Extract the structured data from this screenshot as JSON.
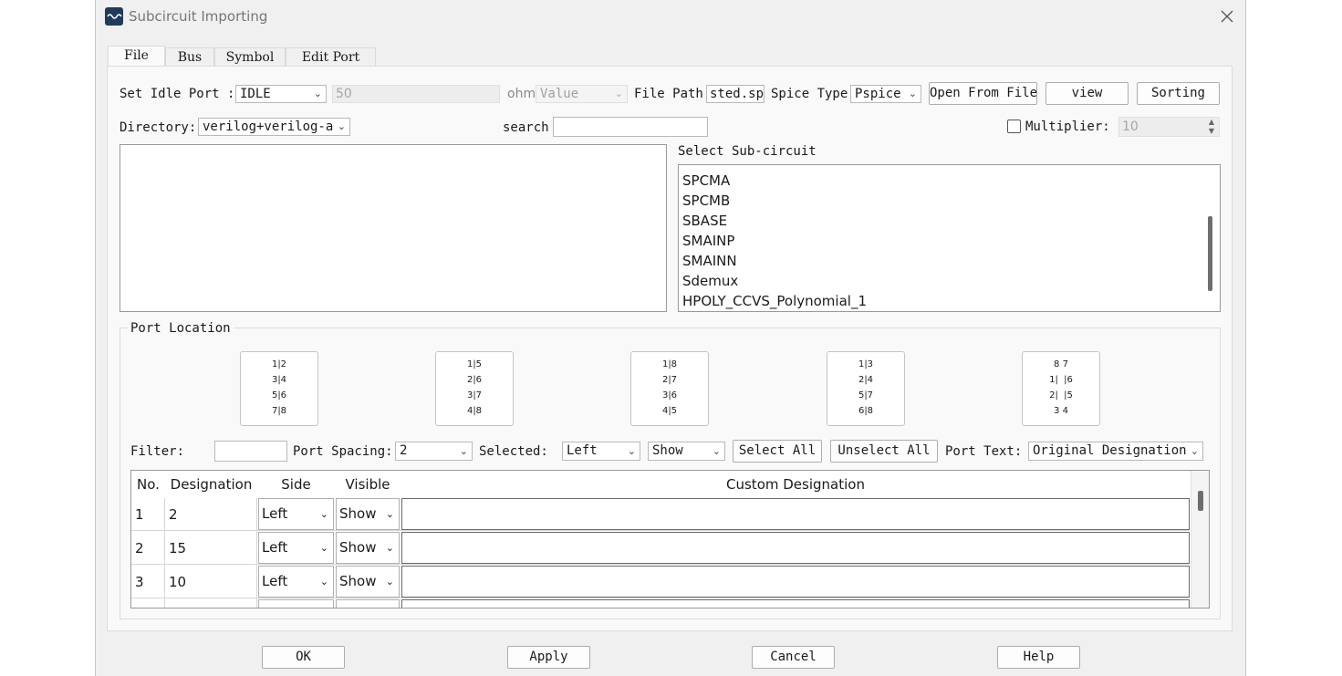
{
  "window": {
    "title": "Subcircuit Importing"
  },
  "tabs": [
    {
      "label": "File"
    },
    {
      "label": "Bus"
    },
    {
      "label": "Symbol"
    },
    {
      "label": "Edit Port"
    }
  ],
  "row1": {
    "idle_port_label": "Set Idle Port :",
    "idle_port_value": "IDLE",
    "resistance_value": "50",
    "ohm_label": "ohm",
    "value_combo": "Value",
    "file_path_label": "File Path",
    "file_path_value": "sted.sp",
    "spice_type_label": "Spice Type",
    "spice_type_value": "Pspice",
    "open_from_file": "Open From File",
    "view": "view",
    "sorting": "Sorting"
  },
  "row2": {
    "directory_label": "Directory:",
    "directory_value": "verilog+verilog-a",
    "search_label": "search",
    "search_value": "",
    "multiplier_label": "Multiplier:",
    "multiplier_value": "10"
  },
  "subcircuit": {
    "label": "Select Sub-circuit",
    "items": [
      "SPCMA",
      "SPCMB",
      "SBASE",
      "SMAINP",
      "SMAINN",
      "Sdemux",
      "HPOLY_CCVS_Polynomial_1"
    ]
  },
  "port_location": {
    "label": "Port Location",
    "patterns": [
      [
        "1|2",
        "3|4",
        "5|6",
        "7|8"
      ],
      [
        "1|5",
        "2|6",
        "3|7",
        "4|8"
      ],
      [
        "1|8",
        "2|7",
        "3|6",
        "4|5"
      ],
      [
        "1|3",
        "2|4",
        "5|7",
        "6|8"
      ],
      [
        "8 7",
        "1|  |6",
        "2|  |5",
        "3 4"
      ]
    ]
  },
  "filter_row": {
    "filter_label": "Filter:",
    "filter_value": "",
    "port_spacing_label": "Port Spacing:",
    "port_spacing_value": "2",
    "selected_label": "Selected:",
    "selected_side": "Left",
    "selected_visible": "Show",
    "select_all": "Select All",
    "unselect_all": "Unselect All",
    "port_text_label": "Port Text:",
    "port_text_value": "Original Designation"
  },
  "table": {
    "headers": [
      "No.",
      "Designation",
      "Side",
      "Visible",
      "Custom Designation"
    ],
    "rows": [
      {
        "no": "1",
        "designation": "2",
        "side": "Left",
        "visible": "Show",
        "custom": ""
      },
      {
        "no": "2",
        "designation": "15",
        "side": "Left",
        "visible": "Show",
        "custom": ""
      },
      {
        "no": "3",
        "designation": "10",
        "side": "Left",
        "visible": "Show",
        "custom": ""
      }
    ]
  },
  "footer": {
    "ok": "OK",
    "apply": "Apply",
    "cancel": "Cancel",
    "help": "Help"
  },
  "colors": {
    "dialog_bg": "#f0f0f0",
    "app_icon_bg": "#1f3a5a",
    "scrollbar_thumb": "#6e6e6e"
  }
}
